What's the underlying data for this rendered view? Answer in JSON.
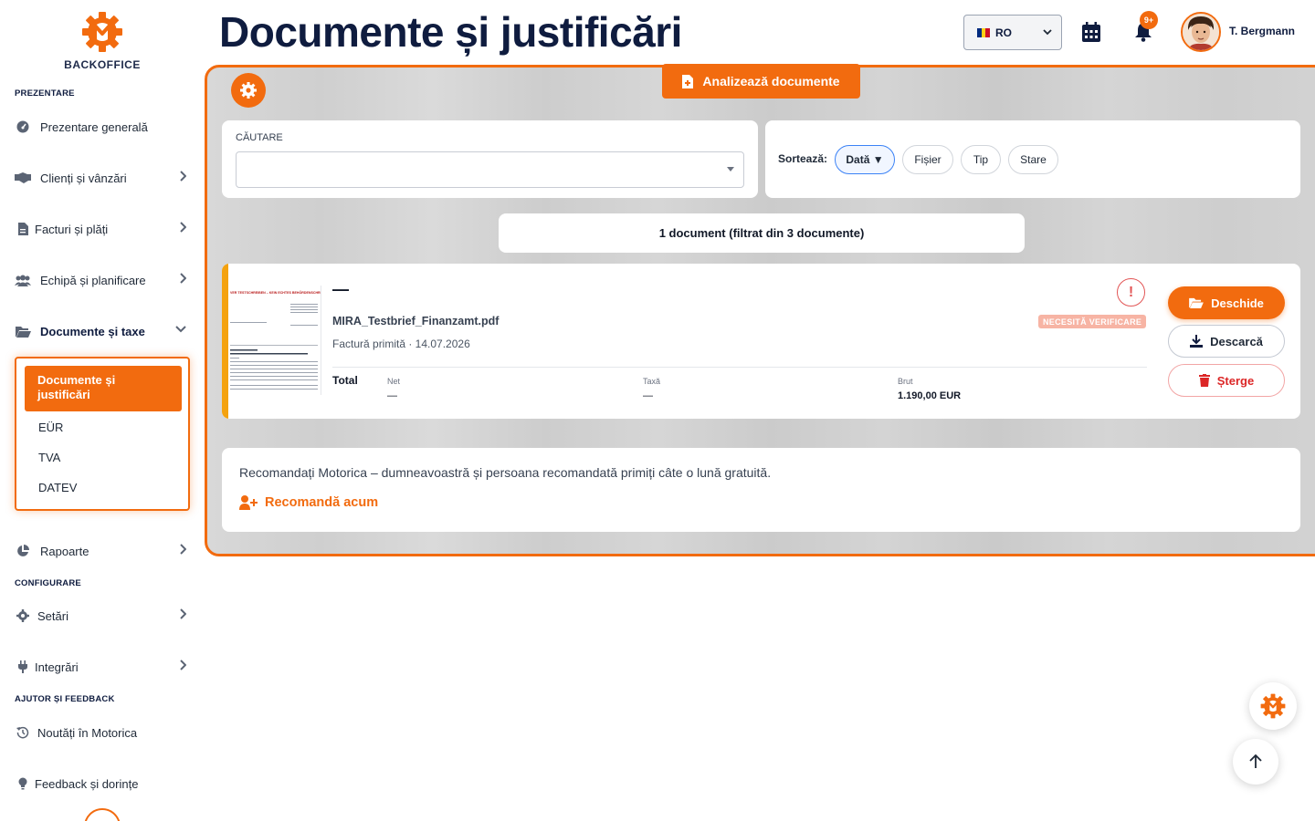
{
  "app": {
    "logo_text": "BACKOFFICE",
    "accent_color": "#f26b0f",
    "title_color": "#0f1c3f"
  },
  "sidebar": {
    "section_overview": "PREZENTARE",
    "section_config": "CONFIGURARE",
    "section_help": "AJUTOR ȘI FEEDBACK",
    "items": [
      {
        "label": "Prezentare generală",
        "icon": "gauge-icon"
      },
      {
        "label": "Clienți și vânzări",
        "icon": "handshake-icon"
      },
      {
        "label": "Facturi și plăți",
        "icon": "invoice-icon"
      },
      {
        "label": "Echipă și planificare",
        "icon": "team-icon"
      },
      {
        "label": "Documente și taxe",
        "icon": "folder-open-icon"
      },
      {
        "label": "Rapoarte",
        "icon": "pie-chart-icon"
      },
      {
        "label": "Setări",
        "icon": "gear-icon"
      },
      {
        "label": "Integrări",
        "icon": "plug-icon"
      },
      {
        "label": "Noutăți în Motorica",
        "icon": "history-icon"
      },
      {
        "label": "Feedback și dorințe",
        "icon": "lightbulb-icon"
      }
    ],
    "submenu": {
      "active": "Documente și justificări",
      "items": [
        "EÜR",
        "TVA",
        "DATEV"
      ]
    }
  },
  "header": {
    "title": "Documente și justificări",
    "language": "RO",
    "notifications_badge": "9+",
    "user_name": "T. Bergmann"
  },
  "toolbar": {
    "analyze_label": "Analizează documente"
  },
  "search": {
    "label": "CĂUTARE",
    "value": ""
  },
  "sort": {
    "label": "Sortează:",
    "options": [
      "Dată ▼",
      "Fișier",
      "Tip",
      "Stare"
    ],
    "active_index": 0
  },
  "results": {
    "count_text": "1 document (filtrat din 3 documente)"
  },
  "documents": [
    {
      "title": "—",
      "filename": "MIRA_Testbrief_Finanzamt.pdf",
      "subtitle": "Factură primită · 14.07.2026",
      "status": "NECESITĂ VERIFICARE",
      "warning_symbol": "!",
      "total_label": "Total",
      "net_label": "Net",
      "net_value": "—",
      "tax_label": "Taxă",
      "tax_value": "—",
      "gross_label": "Brut",
      "gross_value": "1.190,00 EUR",
      "open_label": "Deschide",
      "download_label": "Descarcă",
      "delete_label": "Șterge",
      "thumbnail_heading": "VER TESTSCHREIBEN – KEIN ECHTES BEHÖRDENSCHREIBEN"
    }
  ],
  "referral": {
    "text": "Recomandați Motorica – dumneavoastră și persoana recomandată primiți câte o lună gratuită.",
    "link_label": "Recomandă acum"
  }
}
